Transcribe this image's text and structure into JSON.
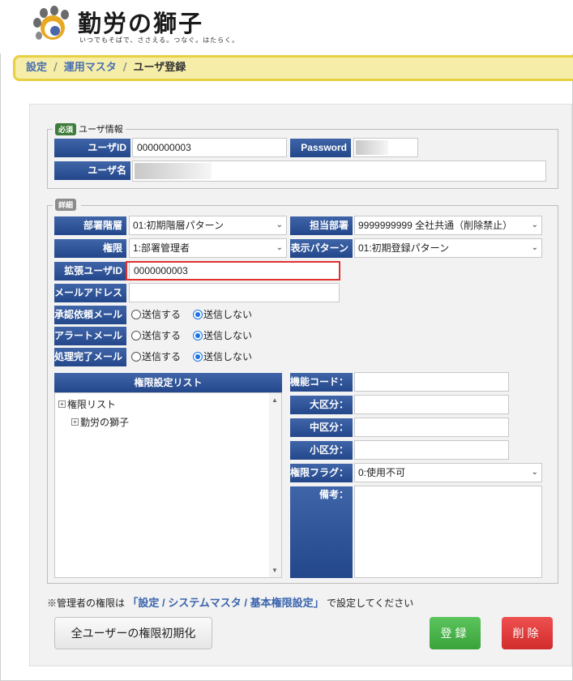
{
  "header": {
    "logo_title": "勤労の獅子",
    "logo_tagline": "いつでもそばで、ささえる。つなぐ。はたらく。"
  },
  "breadcrumb": {
    "items": [
      "設定",
      "運用マスタ"
    ],
    "current": "ユーザ登録",
    "separator": "/"
  },
  "user_info": {
    "badge": "必須",
    "legend": "ユーザ情報",
    "user_id_label": "ユーザID",
    "user_id_value": "0000000003",
    "password_label": "Password",
    "user_name_label": "ユーザ名"
  },
  "details": {
    "legend": "詳細",
    "dept_level_label": "部署階層",
    "dept_level_value": "01:初期階層パターン",
    "assigned_dept_label": "担当部署",
    "assigned_dept_value": "9999999999 全社共通（削除禁止）",
    "authority_label": "権限",
    "authority_value": "1:部署管理者",
    "display_pattern_label": "表示パターン",
    "display_pattern_value": "01:初期登録パターン",
    "ext_user_id_label": "拡張ユーザID",
    "ext_user_id_value": "0000000003",
    "email_label": "メールアドレス",
    "approval_mail_label": "承認依頼メール",
    "alert_mail_label": "アラートメール",
    "complete_mail_label": "処理完了メール",
    "send_label": "送信する",
    "no_send_label": "送信しない"
  },
  "permission": {
    "list_header": "権限設定リスト",
    "tree_root": "権限リスト",
    "tree_child": "勤労の獅子",
    "func_code_label": "機能コード：",
    "major_label": "大区分：",
    "middle_label": "中区分：",
    "minor_label": "小区分：",
    "flag_label": "権限フラグ：",
    "flag_value": "0:使用不可",
    "remarks_label": "備考："
  },
  "note": {
    "prefix": "※管理者の権限は",
    "link": "「設定 / システムマスタ / 基本権限設定」",
    "suffix": "で設定してください"
  },
  "buttons": {
    "reset": "全ユーザーの権限初期化",
    "save": "登録",
    "delete": "削除"
  },
  "colors": {
    "label_bg": "#2b4f92",
    "breadcrumb_bg": "#f6eda8",
    "save": "#45b045",
    "delete": "#e03c3c",
    "highlight": "#e03030"
  }
}
